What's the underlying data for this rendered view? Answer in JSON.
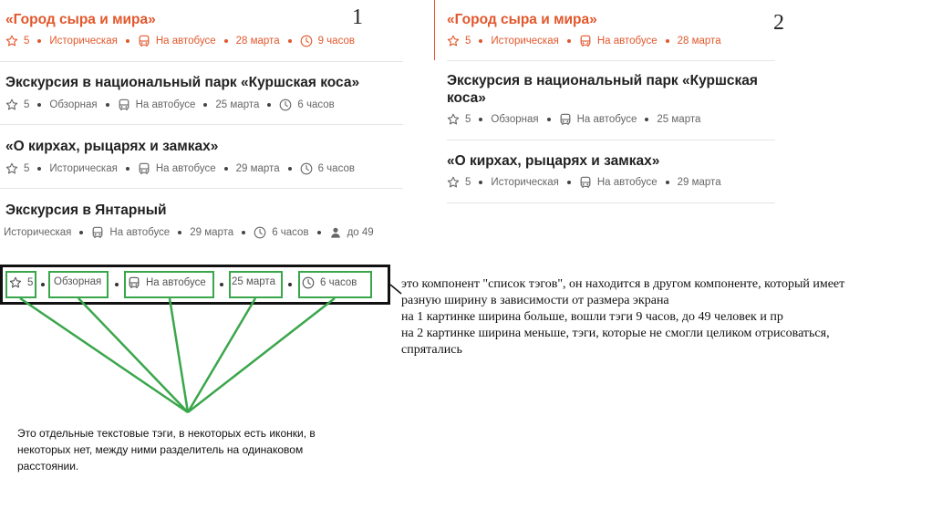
{
  "panel1": {
    "number": "1",
    "items": [
      {
        "title": "«Город сыра и мира»",
        "rating": "5",
        "type": "Историческая",
        "transport": "На автобусе",
        "date": "28 марта",
        "duration": "9 часов"
      },
      {
        "title": "Экскурсия в национальный парк «Куршская коса»",
        "rating": "5",
        "type": "Обзорная",
        "transport": "На автобусе",
        "date": "25 марта",
        "duration": "6 часов"
      },
      {
        "title": "«О кирхах, рыцарях и замках»",
        "rating": "5",
        "type": "Историческая",
        "transport": "На автобусе",
        "date": "29 марта",
        "duration": "6 часов"
      },
      {
        "title": "Экскурсия в Янтарный",
        "type": "Историческая",
        "transport": "На автобусе",
        "date": "29 марта",
        "duration": "6 часов",
        "people": "до 49"
      }
    ]
  },
  "panel2": {
    "number": "2",
    "items": [
      {
        "title": "«Город сыра и мира»",
        "rating": "5",
        "type": "Историческая",
        "transport": "На автобусе",
        "date": "28 марта"
      },
      {
        "title": "Экскурсия в национальный парк «Куршская коса»",
        "rating": "5",
        "type": "Обзорная",
        "transport": "На автобусе",
        "date": "25 марта"
      },
      {
        "title": "«О кирхах, рыцарях и замках»",
        "rating": "5",
        "type": "Историческая",
        "transport": "На автобусе",
        "date": "29 марта"
      }
    ]
  },
  "demo": {
    "rating": "5",
    "type": "Обзорная",
    "transport": "На автобусе",
    "date": "25 марта",
    "duration": "6 часов"
  },
  "notes": {
    "right": "это компонент \"список тэгов\", он находится в другом компоненте, который имеет разную ширину в зависимости от размера экрана на 1 картинке ширина больше, вошли тэги 9 часов, до 49 человек и пр на 2 картинке ширина меньше, тэги, которые не смогли целиком отрисоваться, спрятались",
    "right_lines": [
      "это компонент \"список тэгов\", он находится в другом компоненте, который имеет",
      "разную ширину в зависимости от размера экрана",
      "на 1 картинке ширина больше, вошли тэги 9 часов, до 49 человек и пр",
      "на 2 картинке ширина меньше, тэги, которые не смогли целиком отрисоваться,",
      "спрятались"
    ],
    "bottom_lines": [
      "Это отдельные текстовые тэги, в некоторых есть иконки, в",
      "некоторых нет, между ними разделитель на одинаковом",
      "расстоянии."
    ]
  },
  "colors": {
    "accent": "#e2572b",
    "annotation_green": "#3aa64b",
    "text": "#222222",
    "muted": "#666666"
  },
  "icons": {
    "rating": "star-icon",
    "transport": "bus-icon",
    "duration": "clock-icon",
    "people": "person-icon"
  }
}
